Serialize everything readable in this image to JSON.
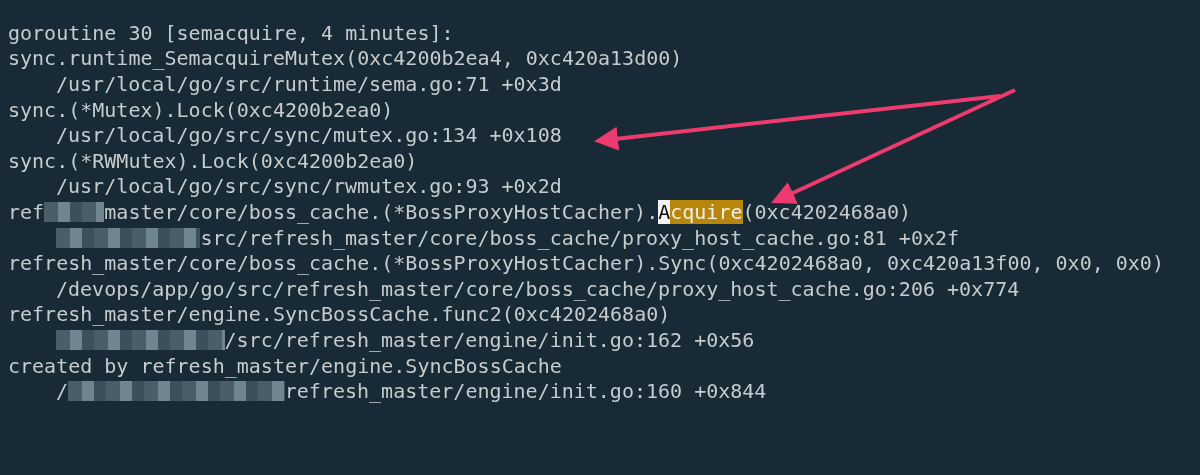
{
  "terminal": {
    "lines": [
      {
        "kind": "header",
        "segments": [
          {
            "kind": "text",
            "text": "goroutine 30 [semacquire, 4 minutes]:"
          }
        ]
      },
      {
        "kind": "call",
        "segments": [
          {
            "kind": "text",
            "text": "sync.runtime_SemacquireMutex(0xc4200b2ea4, 0xc420a13d00)"
          }
        ]
      },
      {
        "kind": "path",
        "segments": [
          {
            "kind": "text",
            "text": "/usr/local/go/src/runtime/sema.go:71 +0x3d"
          }
        ]
      },
      {
        "kind": "call",
        "segments": [
          {
            "kind": "text",
            "text": "sync.(*Mutex).Lock(0xc4200b2ea0)"
          }
        ]
      },
      {
        "kind": "path",
        "segments": [
          {
            "kind": "text",
            "text": "/usr/local/go/src/sync/mutex.go:134 +0x108"
          }
        ]
      },
      {
        "kind": "call",
        "segments": [
          {
            "kind": "text",
            "text": "sync.(*RWMutex).Lock(0xc4200b2ea0)"
          }
        ]
      },
      {
        "kind": "path",
        "segments": [
          {
            "kind": "text",
            "text": "/usr/local/go/src/sync/rwmutex.go:93 +0x2d"
          }
        ]
      },
      {
        "kind": "call",
        "segments": [
          {
            "kind": "text",
            "text": "ref"
          },
          {
            "kind": "redacted"
          },
          {
            "kind": "text",
            "text": "master/core/boss_cache.(*BossProxyHostCacher)."
          },
          {
            "kind": "cursor",
            "text": "A"
          },
          {
            "kind": "match",
            "text": "cquire"
          },
          {
            "kind": "text",
            "text": "(0xc4202468a0)"
          }
        ]
      },
      {
        "kind": "path",
        "segments": [
          {
            "kind": "redacted"
          },
          {
            "kind": "text",
            "text": "src/refresh_master/core/boss_cache/proxy_host_cache.go:81 +0x2f"
          }
        ]
      },
      {
        "kind": "call",
        "segments": [
          {
            "kind": "text",
            "text": "refresh_master/core/boss_cache.(*BossProxyHostCacher).Sync(0xc4202468a0, 0xc420a13f00, 0x0, 0x0)"
          }
        ]
      },
      {
        "kind": "path",
        "segments": [
          {
            "kind": "text",
            "text": "/devops/app/go/src/refresh_master/core/boss_cache/proxy_host_cache.go:206 +0x774"
          }
        ]
      },
      {
        "kind": "call",
        "segments": [
          {
            "kind": "text",
            "text": "refresh_master/engine.SyncBossCache.func2(0xc4202468a0)"
          }
        ]
      },
      {
        "kind": "path",
        "segments": [
          {
            "kind": "redacted"
          },
          {
            "kind": "text",
            "text": "/src/refresh_master/engine/init.go:162 +0x56"
          }
        ]
      },
      {
        "kind": "call",
        "segments": [
          {
            "kind": "text",
            "text": "created by refresh_master/engine.SyncBossCache"
          }
        ]
      },
      {
        "kind": "path",
        "segments": [
          {
            "kind": "text",
            "text": "/"
          },
          {
            "kind": "redacted"
          },
          {
            "kind": "text",
            "text": "refresh_master/engine/init.go:160 +0x844"
          }
        ]
      }
    ]
  }
}
